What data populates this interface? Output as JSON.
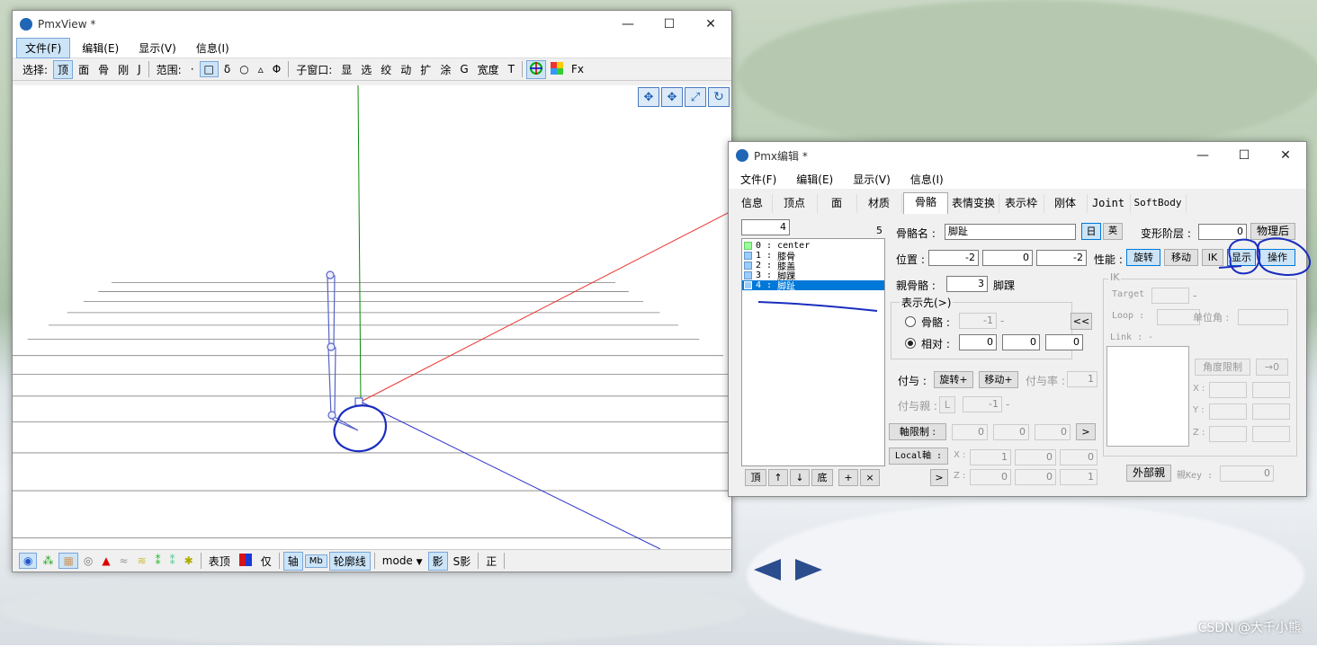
{
  "pmxview": {
    "title": "PmxView *",
    "menu": [
      "文件(F)",
      "编辑(E)",
      "显示(V)",
      "信息(I)"
    ],
    "toolbar": {
      "select_label": "选择:",
      "select_items": [
        "顶",
        "面",
        "骨",
        "刚",
        "J"
      ],
      "range_label": "范围:",
      "range_items": [
        "·",
        "□",
        "δ",
        "○",
        "▵",
        "Φ"
      ],
      "subwin_label": "子窗口:",
      "subwin_items": [
        "显",
        "选",
        "绞",
        "动",
        "扩",
        "涂",
        "G",
        "宽度",
        "T"
      ],
      "fx_label": "Fx"
    },
    "bottom_toolbar": {
      "hyochou": "表顶",
      "only": "仅",
      "axis": "轴",
      "mmd": "Mb",
      "outline": "轮廓线",
      "mode": "mode",
      "shadow": "影",
      "sshadow": "S影",
      "sei": "正"
    }
  },
  "pmxedit": {
    "title": "Pmx编辑 *",
    "menu": [
      "文件(F)",
      "编辑(E)",
      "显示(V)",
      "信息(I)"
    ],
    "tabs": [
      "信息",
      "顶点",
      "面",
      "材质",
      "骨骼",
      "表情变换",
      "表示枠",
      "刚体",
      "Joint",
      "SoftBody"
    ],
    "active_tab": "骨骼",
    "bone_index": "4",
    "bone_count": "5",
    "bones": [
      {
        "idx": "0",
        "name": "center"
      },
      {
        "idx": "1",
        "name": "膝骨"
      },
      {
        "idx": "2",
        "name": "膝盖"
      },
      {
        "idx": "3",
        "name": "脚踝"
      },
      {
        "idx": "4",
        "name": "脚趾"
      }
    ],
    "list_buttons": [
      "頂",
      "↑",
      "↓",
      "底",
      "+",
      "×"
    ],
    "bone_name_label": "骨骼名 :",
    "bone_name_value": "脚趾",
    "btn_jp": "日",
    "btn_en": "英",
    "deform_label": "变形阶层 :",
    "deform_value": "0",
    "physics_after": "物理后",
    "position_label": "位置 :",
    "position": [
      "-2",
      "0",
      "-2"
    ],
    "perf_label": "性能 :",
    "perf_buttons": [
      "旋转",
      "移动",
      "IK",
      "显示",
      "操作"
    ],
    "parent_label": "親骨骼 :",
    "parent_value": "3",
    "parent_name": "脚踝",
    "display_dest_label": "表示先(>)",
    "radio_bone_label": "骨骼 :",
    "radio_bone_value": "-1",
    "radio_bone_dash": "-",
    "collapse_btn": "<<",
    "radio_rel_label": "相对 :",
    "rel_values": [
      "0",
      "0",
      "0"
    ],
    "grant_label": "付与 :",
    "grant_rot": "旋转+",
    "grant_move": "移动+",
    "grant_rate_label": "付与率 :",
    "grant_rate": "1",
    "grant_parent_label": "付与親 :",
    "grant_parent_l": "L",
    "grant_parent_value": "-1",
    "grant_parent_dash": "-",
    "axis_limit_btn": "軸限制 :",
    "axis_limit_values": [
      "0",
      "0",
      "0"
    ],
    "arrow_right": ">",
    "local_axis_btn": "Local軸 :",
    "local_x_label": "X :",
    "local_x": [
      "1",
      "0",
      "0"
    ],
    "local_z_label": "Z :",
    "local_z": [
      "0",
      "0",
      "1"
    ],
    "ik": {
      "title": "IK",
      "target_label": "Target :",
      "target_dash": "-",
      "loop_label": "Loop :",
      "unit_angle_label": "单位角 :",
      "link_label": "Link : -",
      "angle_limit": "角度限制",
      "arrow_zero": "→0",
      "x_label": "X :",
      "y_label": "Y :",
      "z_label": "Z :"
    },
    "external_parent": "外部親",
    "parent_key_label": "親Key :",
    "parent_key_value": "0"
  },
  "watermark": "CSDN @大千小熊",
  "colors": {
    "selection": "#0078d7",
    "annotation": "#1a2dbf",
    "grid": "#808080"
  }
}
